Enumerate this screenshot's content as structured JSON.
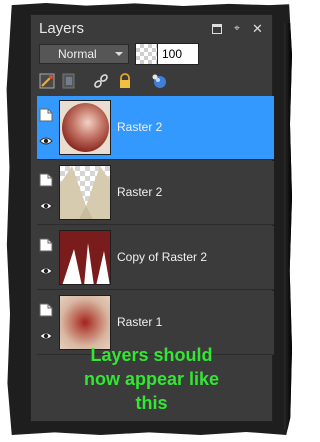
{
  "panel": {
    "title": "Layers",
    "titlebar_icons": [
      "maximize-icon",
      "pin-icon",
      "close-icon"
    ],
    "blend_mode": "Normal",
    "opacity": "100"
  },
  "toolbar": {
    "icons": [
      "brush-icon",
      "mask-icon",
      "link-icon",
      "lock-icon",
      "color-ball-icon"
    ]
  },
  "layers": [
    {
      "name": "Raster 2",
      "selected": true,
      "thumbnail": "brown sphere"
    },
    {
      "name": "Raster 2",
      "selected": false,
      "thumbnail": "cream petals"
    },
    {
      "name": "Copy of Raster 2",
      "selected": false,
      "thumbnail": "red with white petals"
    },
    {
      "name": "Raster 1",
      "selected": false,
      "thumbnail": "red radial gradient"
    }
  ],
  "caption": {
    "line1": "Layers should",
    "line2": "now appear like",
    "line3": "this"
  },
  "colors": {
    "panel_bg": "#3b3b3b",
    "selected_row": "#3399ff",
    "caption": "#33e633"
  }
}
